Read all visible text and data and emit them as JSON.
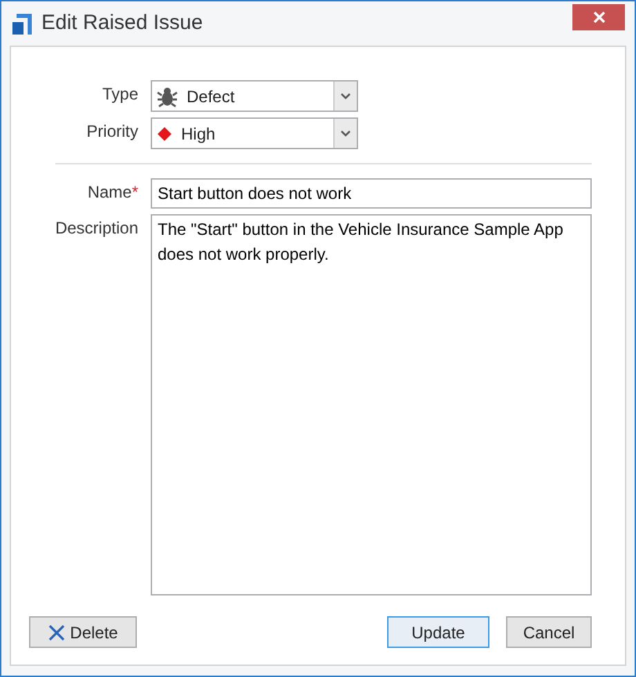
{
  "window": {
    "title": "Edit Raised Issue"
  },
  "fields": [
    {
      "kind": "select",
      "label": "Type",
      "value": "Defect"
    },
    {
      "kind": "select",
      "label": "Priority",
      "value": "High"
    },
    {
      "kind": "separator"
    },
    {
      "kind": "text",
      "label": "Name",
      "required_mark": "*",
      "value": "Start button does not work"
    },
    {
      "kind": "textarea",
      "label": "Description",
      "value": "The \"Start\" button in the Vehicle Insurance Sample App does not work properly."
    }
  ],
  "buttons": [
    {
      "label": "Delete",
      "default": false
    },
    {
      "label": "Update",
      "default": true
    },
    {
      "label": "Cancel",
      "default": false
    }
  ]
}
